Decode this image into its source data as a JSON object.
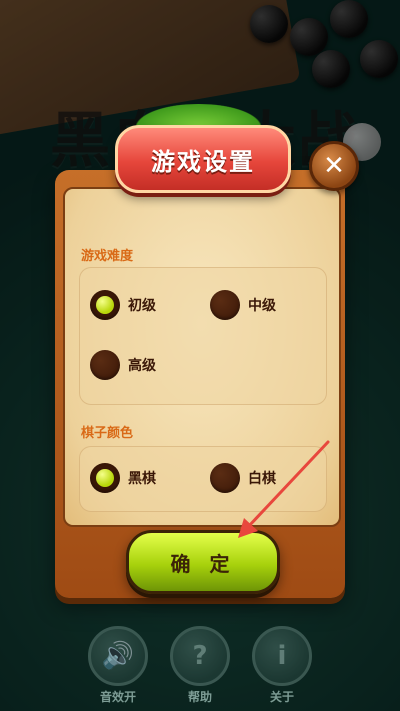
{
  "background": {
    "title": "黑白棋大战"
  },
  "dialog": {
    "title": "游戏设置",
    "close_icon": "close-icon",
    "difficulty": {
      "label": "游戏难度",
      "options": [
        {
          "label": "初级",
          "selected": true
        },
        {
          "label": "中级",
          "selected": false
        },
        {
          "label": "高级",
          "selected": false
        }
      ]
    },
    "piece_color": {
      "label": "棋子颜色",
      "options": [
        {
          "label": "黑棋",
          "selected": true
        },
        {
          "label": "白棋",
          "selected": false
        }
      ]
    },
    "confirm_label": "确 定"
  },
  "bottom_bar": [
    {
      "label": "音效开",
      "icon": "speaker-icon"
    },
    {
      "label": "帮助",
      "icon": "question-icon"
    },
    {
      "label": "关于",
      "icon": "info-icon"
    }
  ],
  "colors": {
    "accent_orange": "#d96a17",
    "banner_red": "#e6463b",
    "confirm_green": "#a7d10c",
    "annotation_arrow": "#e8473d"
  }
}
